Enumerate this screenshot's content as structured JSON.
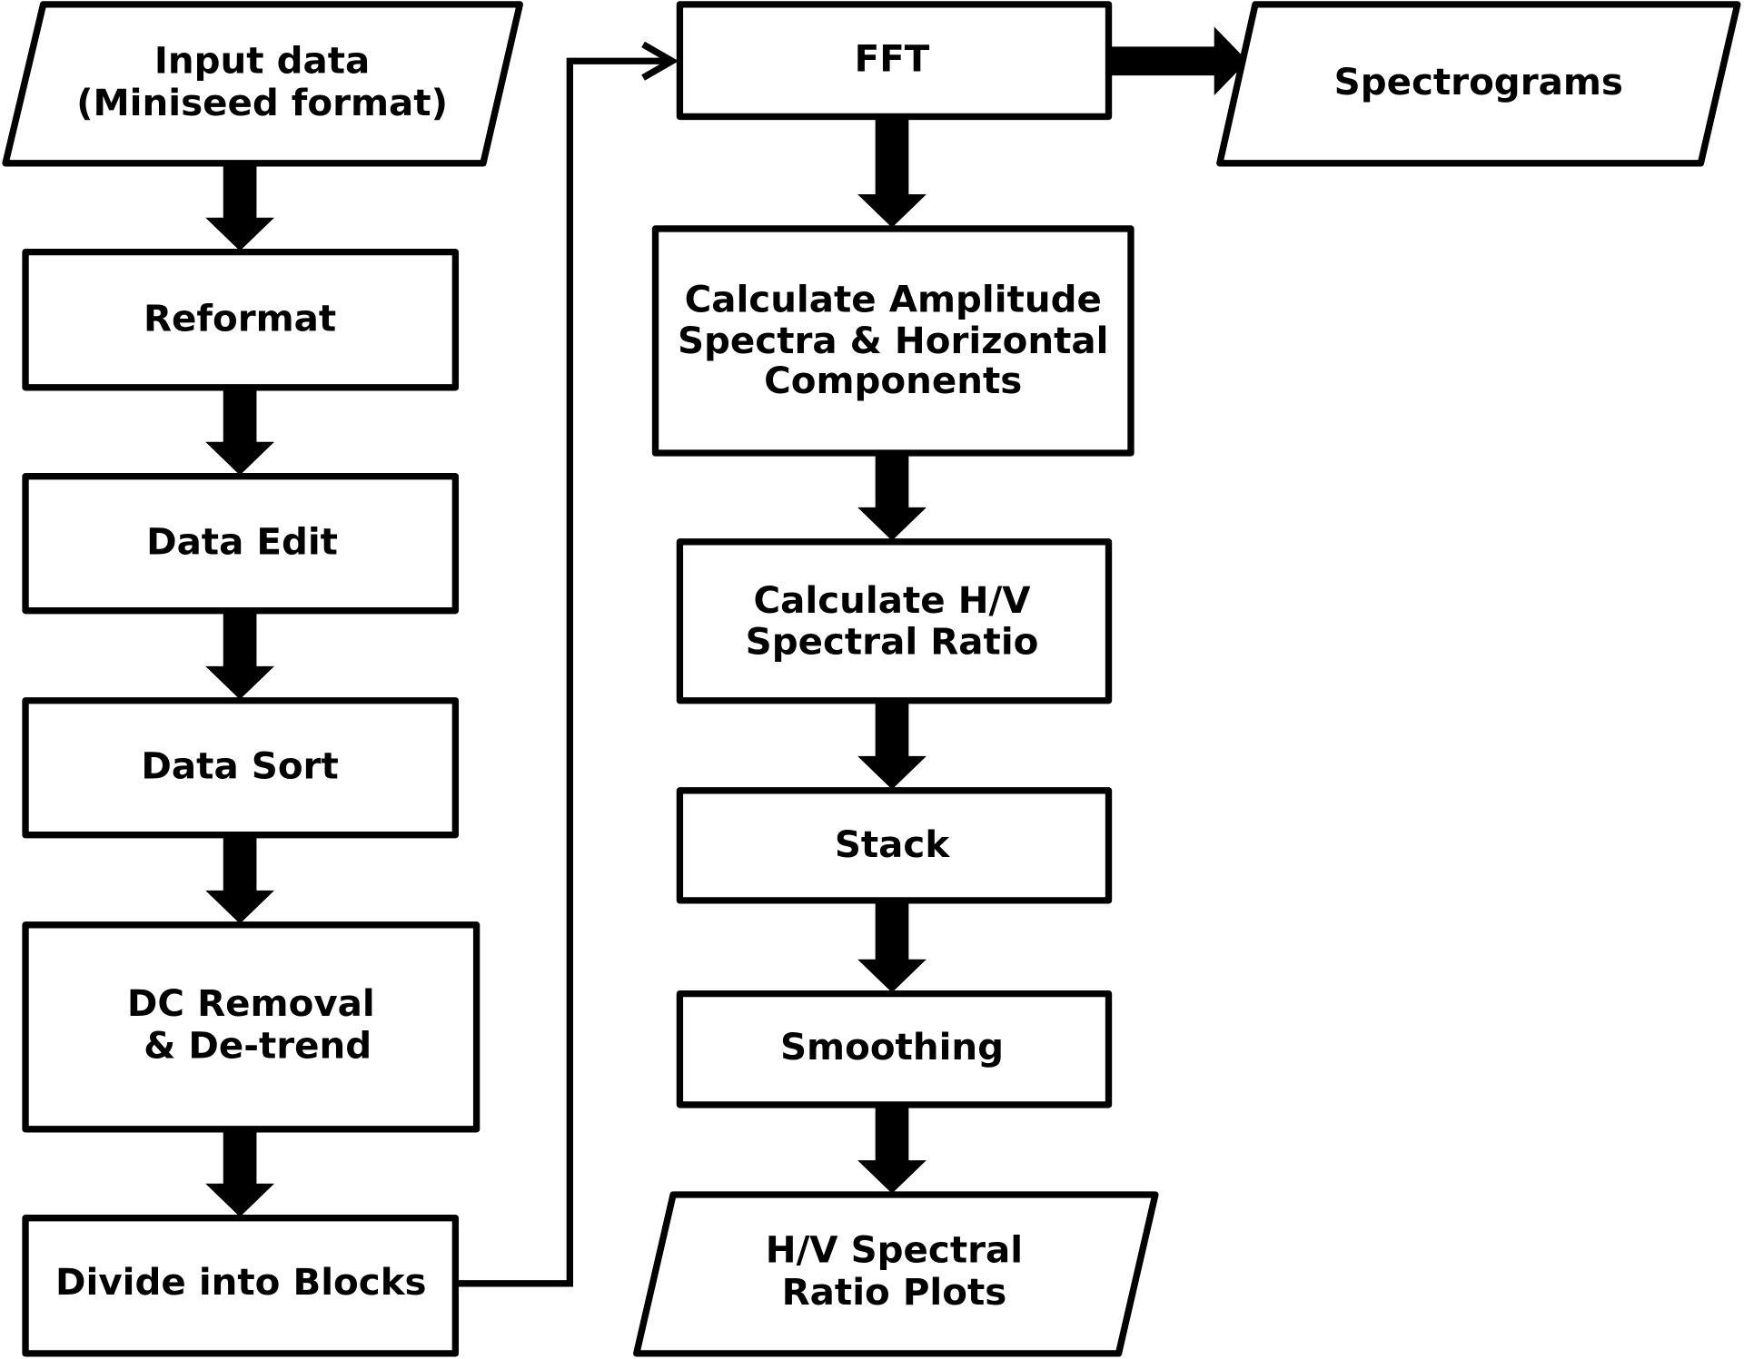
{
  "diagram": {
    "type": "flowchart",
    "nodes": {
      "input_data": {
        "shape": "parallelogram",
        "lines": [
          "Input data",
          "(Miniseed format)"
        ]
      },
      "reformat": {
        "shape": "rectangle",
        "lines": [
          "Reformat"
        ]
      },
      "data_edit": {
        "shape": "rectangle",
        "lines": [
          "Data Edit"
        ]
      },
      "data_sort": {
        "shape": "rectangle",
        "lines": [
          "Data Sort"
        ]
      },
      "dc_removal": {
        "shape": "rectangle",
        "lines": [
          "DC Removal",
          "& De-trend"
        ]
      },
      "divide_blocks": {
        "shape": "rectangle",
        "lines": [
          "Divide into Blocks"
        ]
      },
      "fft": {
        "shape": "rectangle",
        "lines": [
          "FFT"
        ]
      },
      "spectrograms": {
        "shape": "parallelogram",
        "lines": [
          "Spectrograms"
        ]
      },
      "calc_amplitude": {
        "shape": "rectangle",
        "lines": [
          "Calculate Amplitude",
          "Spectra & Horizontal",
          "Components"
        ]
      },
      "calc_hv": {
        "shape": "rectangle",
        "lines": [
          "Calculate H/V",
          "Spectral Ratio"
        ]
      },
      "stack": {
        "shape": "rectangle",
        "lines": [
          "Stack"
        ]
      },
      "smoothing": {
        "shape": "rectangle",
        "lines": [
          "Smoothing"
        ]
      },
      "hv_plots": {
        "shape": "parallelogram",
        "lines": [
          "H/V Spectral",
          "Ratio Plots"
        ]
      }
    },
    "edges": [
      [
        "input_data",
        "reformat"
      ],
      [
        "reformat",
        "data_edit"
      ],
      [
        "data_edit",
        "data_sort"
      ],
      [
        "data_sort",
        "dc_removal"
      ],
      [
        "dc_removal",
        "divide_blocks"
      ],
      [
        "divide_blocks",
        "fft"
      ],
      [
        "fft",
        "spectrograms"
      ],
      [
        "fft",
        "calc_amplitude"
      ],
      [
        "calc_amplitude",
        "calc_hv"
      ],
      [
        "calc_hv",
        "stack"
      ],
      [
        "stack",
        "smoothing"
      ],
      [
        "smoothing",
        "hv_plots"
      ]
    ]
  }
}
